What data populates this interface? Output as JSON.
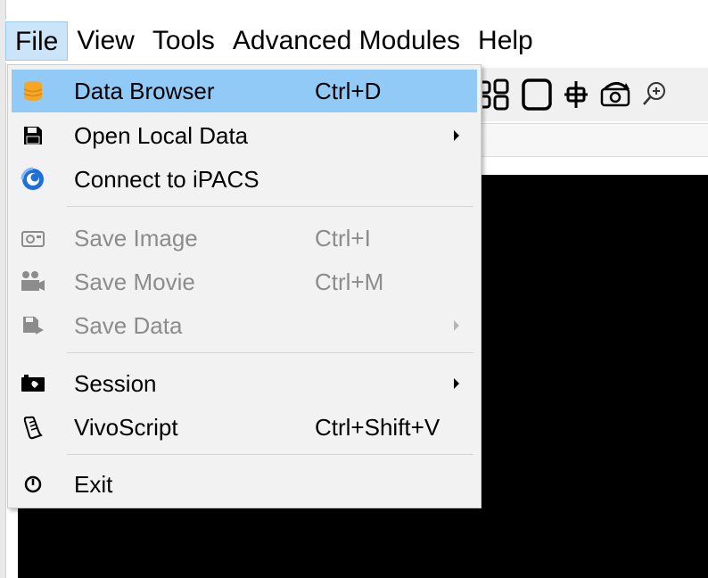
{
  "menubar": {
    "items": [
      {
        "label": "File"
      },
      {
        "label": "View"
      },
      {
        "label": "Tools"
      },
      {
        "label": "Advanced Modules"
      },
      {
        "label": "Help"
      }
    ]
  },
  "file_menu": {
    "items": [
      {
        "label": "Data Browser",
        "shortcut": "Ctrl+D",
        "icon": "database-icon",
        "enabled": true,
        "highlighted": true
      },
      {
        "label": "Open Local Data",
        "shortcut": "",
        "icon": "floppy-disk-icon",
        "enabled": true,
        "submenu": true
      },
      {
        "label": "Connect to iPACS",
        "shortcut": "",
        "icon": "ipacs-logo-icon",
        "enabled": true
      },
      {
        "label": "Save Image",
        "shortcut": "Ctrl+I",
        "icon": "camera-icon",
        "enabled": false
      },
      {
        "label": "Save Movie",
        "shortcut": "Ctrl+M",
        "icon": "video-camera-icon",
        "enabled": false
      },
      {
        "label": "Save Data",
        "shortcut": "",
        "icon": "save-data-icon",
        "enabled": false,
        "submenu": true
      },
      {
        "label": "Session",
        "shortcut": "",
        "icon": "session-icon",
        "enabled": true,
        "submenu": true
      },
      {
        "label": "VivoScript",
        "shortcut": "Ctrl+Shift+V",
        "icon": "script-icon",
        "enabled": true
      },
      {
        "label": "Exit",
        "shortcut": "",
        "icon": "power-icon",
        "enabled": true
      }
    ]
  },
  "toolbar": {
    "icons": [
      "layout-grid-icon",
      "square-icon",
      "crosshair-move-icon",
      "rotate-camera-icon",
      "zoom-in-icon"
    ]
  },
  "colors": {
    "highlight": "#91c9f7",
    "menubar_active": "#cce4f7",
    "disabled_text": "#8c8c8c",
    "database_icon": "#f5a623",
    "ipacs_icon": "#1e6fd9"
  }
}
